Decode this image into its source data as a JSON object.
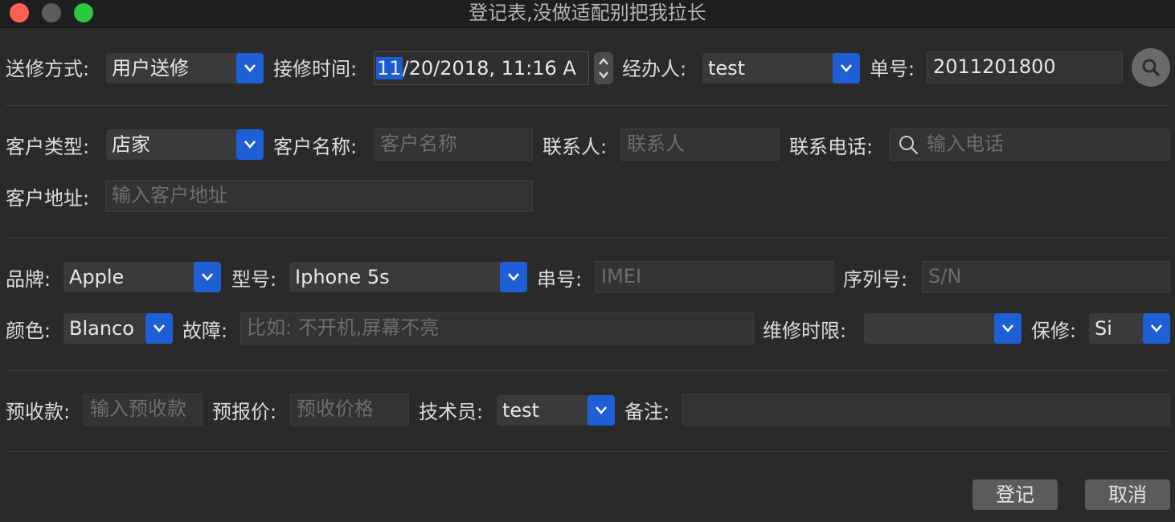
{
  "window": {
    "title": "登记表,没做适配别把我拉长"
  },
  "row1": {
    "method_label": "送修方式:",
    "method_value": "用户送修",
    "time_label": "接修时间:",
    "time_selected": "11",
    "time_rest": "/20/2018, 11:16 A",
    "handler_label": "经办人:",
    "handler_value": "test",
    "order_label": "单号:",
    "order_value": "2011201800"
  },
  "customer": {
    "type_label": "客户类型:",
    "type_value": "店家",
    "name_label": "客户名称:",
    "name_placeholder": "客户名称",
    "contact_label": "联系人:",
    "contact_placeholder": "联系人",
    "phone_label": "联系电话:",
    "phone_placeholder": "输入电话",
    "address_label": "客户地址:",
    "address_placeholder": "输入客户地址"
  },
  "device": {
    "brand_label": "品牌:",
    "brand_value": "Apple",
    "model_label": "型号:",
    "model_value": "Iphone 5s",
    "serial_label": "串号:",
    "serial_placeholder": "IMEI",
    "sn_label": "序列号:",
    "sn_placeholder": "S/N",
    "color_label": "颜色:",
    "color_value": "Blanco",
    "fault_label": "故障:",
    "fault_placeholder": "比如: 不开机,屏幕不亮",
    "deadline_label": "维修时限:",
    "deadline_value": "",
    "warranty_label": "保修:",
    "warranty_value": "Si"
  },
  "payment": {
    "prepay_label": "预收款:",
    "prepay_placeholder": "输入预收款",
    "quote_label": "预报价:",
    "quote_placeholder": "预收价格",
    "tech_label": "技术员:",
    "tech_value": "test",
    "note_label": "备注:",
    "note_value": ""
  },
  "buttons": {
    "register": "登记",
    "cancel": "取消"
  },
  "colors": {
    "accent": "#1f5fd6",
    "background": "#2a2a2b",
    "close": "#fe5f57",
    "maximize": "#28c840"
  },
  "icons": {
    "search_button": "magnifier-icon",
    "phone_search": "search-icon",
    "dropdown": "chevron-down-icon",
    "stepper": "stepper-icon"
  }
}
